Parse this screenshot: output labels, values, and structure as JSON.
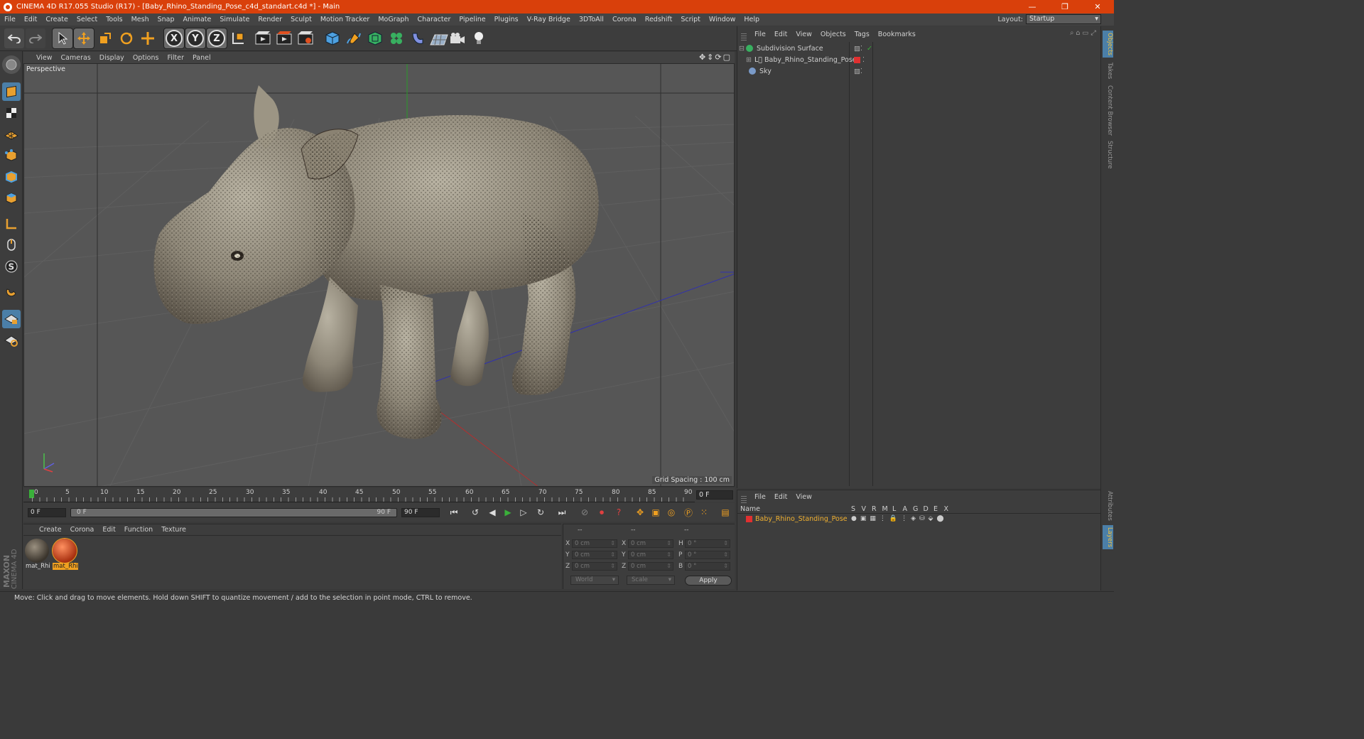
{
  "window": {
    "title": "CINEMA 4D R17.055 Studio (R17) - [Baby_Rhino_Standing_Pose_c4d_standart.c4d *] - Main",
    "minimize": "—",
    "maximize": "❐",
    "close": "✕"
  },
  "menubar": {
    "items": [
      "File",
      "Edit",
      "Create",
      "Select",
      "Tools",
      "Mesh",
      "Snap",
      "Animate",
      "Simulate",
      "Render",
      "Sculpt",
      "Motion Tracker",
      "MoGraph",
      "Character",
      "Pipeline",
      "Plugins",
      "V-Ray Bridge",
      "3DToAll",
      "Corona",
      "Redshift",
      "Script",
      "Window",
      "Help"
    ],
    "layout_label": "Layout:",
    "layout_value": "Startup"
  },
  "toolbar": {
    "axis_x": "X",
    "axis_y": "Y",
    "axis_z": "Z"
  },
  "viewport": {
    "menu": [
      "View",
      "Cameras",
      "Display",
      "Options",
      "Filter",
      "Panel"
    ],
    "label": "Perspective",
    "grid_spacing": "Grid Spacing : 100 cm"
  },
  "timeline": {
    "ticks": [
      "0",
      "5",
      "10",
      "15",
      "20",
      "25",
      "30",
      "35",
      "40",
      "45",
      "50",
      "55",
      "60",
      "65",
      "70",
      "75",
      "80",
      "85",
      "90"
    ],
    "current_frame": "0 F",
    "start_field": "0 F",
    "range_start": "0 F",
    "range_end": "90 F",
    "end_field": "90 F"
  },
  "materials": {
    "menu": [
      "Create",
      "Corona",
      "Edit",
      "Function",
      "Texture"
    ],
    "items": [
      {
        "label": "mat_Rhi",
        "color": "#5a5248"
      },
      {
        "label": "mat_Rhi",
        "color": "#c8502a"
      }
    ]
  },
  "coords": {
    "header": [
      "--",
      "--",
      "--"
    ],
    "rows": [
      {
        "a": "X",
        "av": "0 cm",
        "b": "X",
        "bv": "0 cm",
        "c": "H",
        "cv": "0 °"
      },
      {
        "a": "Y",
        "av": "0 cm",
        "b": "Y",
        "bv": "0 cm",
        "c": "P",
        "cv": "0 °"
      },
      {
        "a": "Z",
        "av": "0 cm",
        "b": "Z",
        "bv": "0 cm",
        "c": "B",
        "cv": "0 °"
      }
    ],
    "world": "World",
    "scale": "Scale",
    "apply": "Apply"
  },
  "maxon": {
    "brand": "MAXON",
    "product": "CINEMA 4D"
  },
  "status": "Move: Click and drag to move elements. Hold down SHIFT to quantize movement / add to the selection in point mode, CTRL to remove.",
  "objects_panel": {
    "menu": [
      "File",
      "Edit",
      "View",
      "Objects",
      "Tags",
      "Bookmarks"
    ],
    "items": [
      {
        "name": "Subdivision Surface",
        "icon_color": "#38b060"
      },
      {
        "name": "Baby_Rhino_Standing_Pose",
        "icon_color": "#c0c0c0"
      },
      {
        "name": "Sky",
        "icon_color": "#7a9ac8"
      }
    ]
  },
  "layers_panel": {
    "menu": [
      "File",
      "Edit",
      "View"
    ],
    "columns": [
      "Name",
      "S",
      "V",
      "R",
      "M",
      "L",
      "A",
      "G",
      "D",
      "E",
      "X"
    ],
    "layer_name": "Baby_Rhino_Standing_Pose",
    "layer_color": "#e03030"
  },
  "right_tabs": [
    "Objects",
    "Takes",
    "Content Browser",
    "Structure",
    "Attributes",
    "Layers"
  ],
  "colors": {
    "title_bar": "#d9400b",
    "accent_blue": "#4b7fa8",
    "layer_text": "#f0b030"
  }
}
